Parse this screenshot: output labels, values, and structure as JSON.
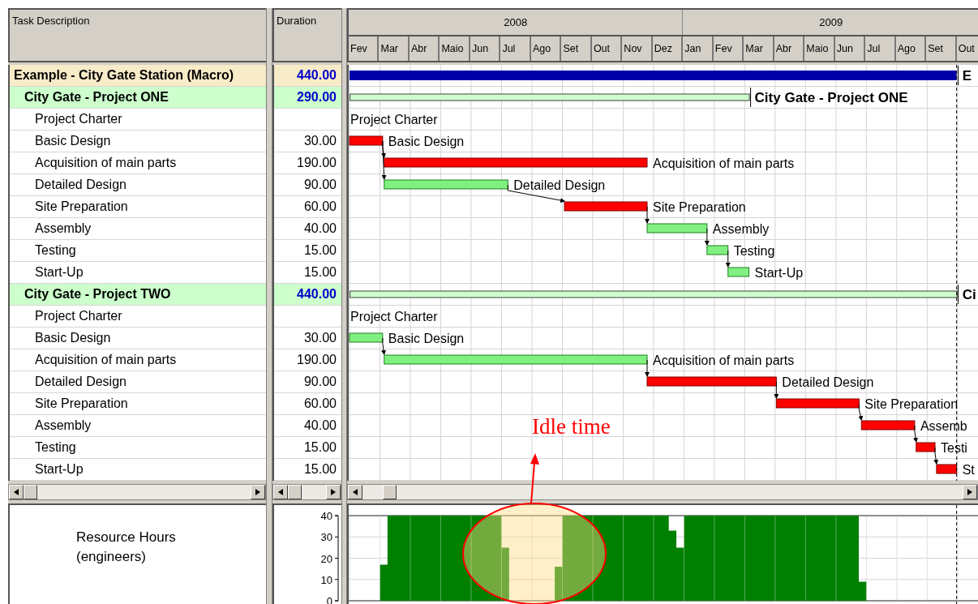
{
  "columns": {
    "task": "Task Description",
    "duration": "Duration"
  },
  "rows": [
    {
      "kind": "macro",
      "name": "Example - City Gate Station (Macro)",
      "duration": "440.00",
      "children": [
        {
          "kind": "project",
          "name": "City Gate - Project ONE",
          "duration": "290.00",
          "children": [
            {
              "kind": "task",
              "name": "Project Charter"
            },
            {
              "kind": "task",
              "name": "Basic Design",
              "duration": "30.00"
            },
            {
              "kind": "task",
              "name": "Acquisition of main parts",
              "duration": "190.00"
            },
            {
              "kind": "task",
              "name": "Detailed Design",
              "duration": "90.00"
            },
            {
              "kind": "task",
              "name": "Site Preparation",
              "duration": "60.00"
            },
            {
              "kind": "task",
              "name": "Assembly",
              "duration": "40.00"
            },
            {
              "kind": "task",
              "name": "Testing",
              "duration": "15.00"
            },
            {
              "kind": "task",
              "name": "Start-Up",
              "duration": "15.00"
            }
          ]
        },
        {
          "kind": "project",
          "name": "City Gate - Project TWO",
          "duration": "440.00",
          "children": [
            {
              "kind": "task",
              "name": "Project Charter"
            },
            {
              "kind": "task",
              "name": "Basic Design",
              "duration": "30.00"
            },
            {
              "kind": "task",
              "name": "Acquisition of main parts",
              "duration": "190.00"
            },
            {
              "kind": "task",
              "name": "Detailed Design",
              "duration": "90.00"
            },
            {
              "kind": "task",
              "name": "Site Preparation",
              "duration": "60.00"
            },
            {
              "kind": "task",
              "name": "Assembly",
              "duration": "40.00"
            },
            {
              "kind": "task",
              "name": "Testing",
              "duration": "15.00"
            },
            {
              "kind": "task",
              "name": "Start-Up",
              "duration": "15.00"
            }
          ]
        }
      ]
    }
  ],
  "gantt": {
    "years": [
      "2008",
      "2009"
    ],
    "months": [
      "Fev",
      "Mar",
      "Abr",
      "Maio",
      "Jun",
      "Jul",
      "Ago",
      "Set",
      "Out",
      "Nov",
      "Dez",
      "Jan",
      "Fev",
      "Mar",
      "Abr",
      "Maio",
      "Jun",
      "Jul",
      "Ago",
      "Set",
      "Out"
    ],
    "bars": [
      {
        "kind": "macro",
        "label": "E"
      },
      {
        "kind": "summary",
        "label": "City Gate - Project ONE"
      },
      {
        "kind": "milestone",
        "label": "Project Charter"
      },
      {
        "kind": "task",
        "label": "Basic Design",
        "critical": true
      },
      {
        "kind": "task",
        "label": "Acquisition of main parts",
        "critical": true
      },
      {
        "kind": "task",
        "label": "Detailed Design",
        "critical": false
      },
      {
        "kind": "task",
        "label": "Site Preparation",
        "critical": true
      },
      {
        "kind": "task",
        "label": "Assembly",
        "critical": false
      },
      {
        "kind": "task",
        "label": "Testing",
        "critical": false
      },
      {
        "kind": "task",
        "label": "Start-Up",
        "critical": false
      },
      {
        "kind": "summary",
        "label": "Ci"
      },
      {
        "kind": "milestone",
        "label": "Project Charter"
      },
      {
        "kind": "task",
        "label": "Basic Design",
        "critical": false
      },
      {
        "kind": "task",
        "label": "Acquisition of main parts",
        "critical": false
      },
      {
        "kind": "task",
        "label": "Detailed Design",
        "critical": true
      },
      {
        "kind": "task",
        "label": "Site Preparation",
        "critical": true
      },
      {
        "kind": "task",
        "label": "Assemb",
        "critical": true
      },
      {
        "kind": "task",
        "label": "Testi",
        "critical": true
      },
      {
        "kind": "task",
        "label": "St",
        "critical": true
      }
    ]
  },
  "resource_panel": {
    "label": "Resource Hours (engineers)",
    "chart_data": {
      "type": "area",
      "grid": true,
      "ylim": [
        0,
        40
      ],
      "yticks": [
        0,
        10,
        20,
        30,
        40
      ],
      "series": [
        {
          "color": "#008000",
          "values": [
            0,
            0,
            0,
            0,
            17,
            40,
            40,
            40,
            40,
            40,
            40,
            40,
            40,
            40,
            40,
            40,
            40,
            40,
            40,
            40,
            25,
            0,
            0,
            0,
            0,
            0,
            0,
            16,
            40,
            40,
            40,
            40,
            40,
            40,
            40,
            40,
            40,
            40,
            40,
            40,
            40,
            40,
            33,
            25,
            40,
            40,
            40,
            40,
            40,
            40,
            40,
            40,
            40,
            40,
            40,
            40,
            40,
            40,
            40,
            40,
            40,
            40,
            40,
            40,
            40,
            40,
            40,
            9,
            0,
            0,
            0,
            0,
            0,
            0,
            0,
            0,
            0,
            0,
            0,
            0,
            0,
            0,
            0
          ]
        }
      ]
    }
  },
  "annotation": {
    "text": "Idle time"
  }
}
